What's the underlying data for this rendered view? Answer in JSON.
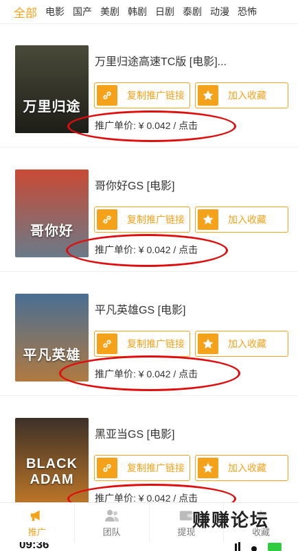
{
  "tabs": [
    "全部",
    "电影",
    "国产",
    "美剧",
    "韩剧",
    "日剧",
    "泰剧",
    "动漫",
    "恐怖"
  ],
  "items": [
    {
      "title": "万里归途高速TC版 [电影]...",
      "poster_text": "万里归途",
      "poster_colors": [
        "#4a4a3a",
        "#1e1e18"
      ]
    },
    {
      "title": "哥你好GS [电影]",
      "poster_text": "哥你好",
      "poster_colors": [
        "#c94a35",
        "#6a7a88"
      ]
    },
    {
      "title": "平凡英雄GS [电影]",
      "poster_text": "平凡英雄",
      "poster_colors": [
        "#4a6e94",
        "#b07a40"
      ]
    },
    {
      "title": "黑亚当GS [电影]",
      "poster_text": "BLACK ADAM",
      "poster_colors": [
        "#3c3028",
        "#c07828"
      ]
    }
  ],
  "buttons": {
    "copy": "复制推广链接",
    "fav": "加入收藏"
  },
  "price": "推广单价: ¥ 0.042 / 点击",
  "nav": [
    {
      "label": "推广",
      "icon": "megaphone-icon"
    },
    {
      "label": "团队",
      "icon": "team-icon"
    },
    {
      "label": "提现",
      "icon": "wallet-icon"
    },
    {
      "label": "收藏",
      "icon": "star-icon"
    }
  ],
  "watermark": "赚赚论坛",
  "status": {
    "time": "09:36"
  },
  "colors": {
    "accent": "#f5a21b",
    "annotation": "#e00d0d"
  }
}
